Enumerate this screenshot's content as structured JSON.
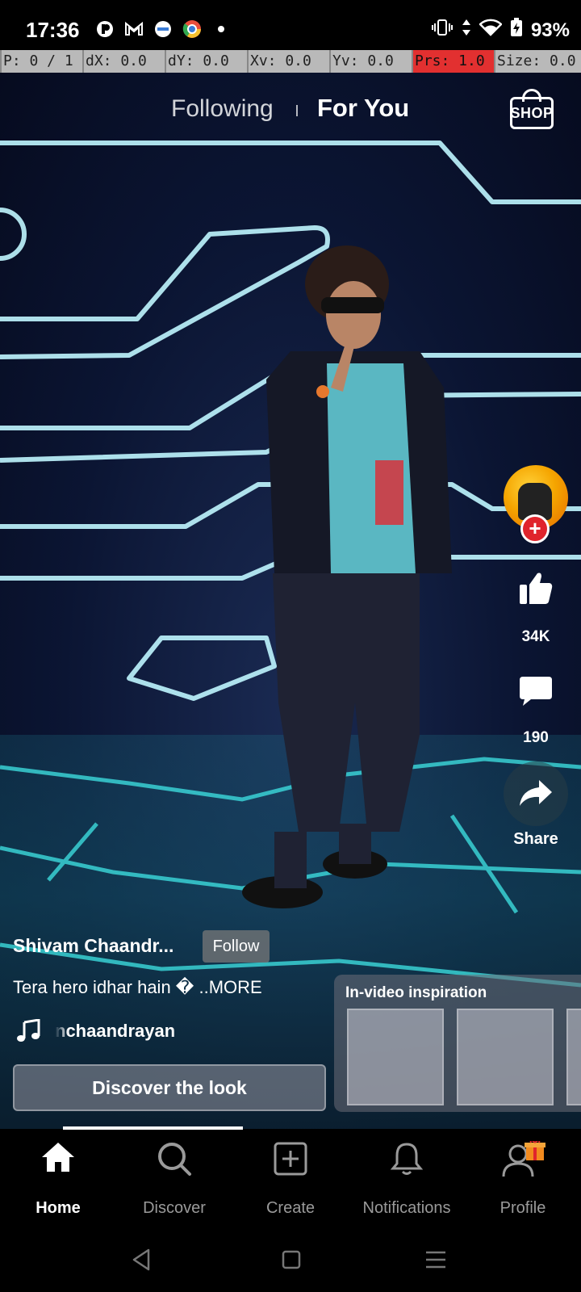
{
  "status_bar": {
    "time": "17:36",
    "battery": "93%",
    "left_icons": [
      "app-icon",
      "gmail-icon",
      "app-icon",
      "chrome-like-icon",
      "dot-icon"
    ],
    "right_icons": [
      "vibrate-icon",
      "data-arrows-icon",
      "wifi-icon",
      "battery-charging-icon"
    ]
  },
  "pointer_bar": {
    "cells": [
      "P: 0 / 1",
      "dX: 0.0",
      "dY: 0.0",
      "Xv: 0.0",
      "Yv: 0.0",
      "Prs: 1.0",
      "Size: 0.0"
    ],
    "highlight_color": "#e23030"
  },
  "top_tabs": {
    "following": "Following",
    "for_you": "For You",
    "shop": "SHOP"
  },
  "actions": {
    "likes": "34K",
    "comments": "190",
    "share": "Share"
  },
  "post": {
    "creator": "Shivam Chaandr...",
    "follow": "Follow",
    "caption": "Tera hero idhar hain � ..MORE",
    "music": "nchaandrayan",
    "discover": "Discover the look",
    "inspiration_title": "In-video inspiration"
  },
  "progress": 0.31,
  "bottom_nav": {
    "items": [
      {
        "label": "Home",
        "icon": "home-icon",
        "active": true
      },
      {
        "label": "Discover",
        "icon": "search-icon",
        "active": false
      },
      {
        "label": "Create",
        "icon": "plus-square-icon",
        "active": false
      },
      {
        "label": "Notifications",
        "icon": "bell-icon",
        "active": false
      },
      {
        "label": "Profile",
        "icon": "profile-icon",
        "active": false
      }
    ]
  },
  "colors": {
    "accent_red": "#e0242c",
    "neon": "#4ff0f0"
  }
}
